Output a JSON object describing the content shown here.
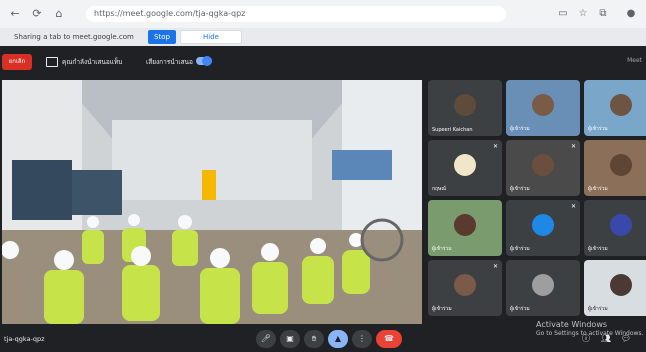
{
  "browser": {
    "url": "https://meet.google.com/tja-qgka-qpz",
    "nav": [
      "back-icon",
      "refresh-icon",
      "home-icon"
    ]
  },
  "share_bar": {
    "message": "Sharing a tab to meet.google.com",
    "stop_label": "Stop",
    "hide_label": "Hide"
  },
  "meet": {
    "stop_label": "ยกเลิก",
    "presenting_label": "คุณกำลังนำเสนอแท็บ",
    "audio_label": "เสียงการนำเสนอ",
    "right_label": "Meet",
    "meeting_code": "tja-qgka-qpz",
    "watermark": "Activate Windows",
    "watermark_sub": "Go to Settings to activate Windows."
  },
  "participants": [
    {
      "name": "Supeeri Kaichan",
      "mic": "muted"
    },
    {
      "name": "ผู้เข้าร่วม",
      "mic": "muted"
    },
    {
      "name": "กฤษณ์",
      "mic": "muted"
    },
    {
      "name": "ผู้เข้าร่วม",
      "mic": "muted"
    },
    {
      "name": "ผู้เข้าร่วม",
      "mic": "muted"
    },
    {
      "name": "ผู้เข้าร่วม",
      "mic": "muted"
    },
    {
      "name": "ผู้เข้าร่วม",
      "mic": "muted"
    },
    {
      "name": "ผู้เข้าร่วม",
      "mic": "muted"
    },
    {
      "name": "ผู้เข้าร่วม",
      "mic": "muted"
    },
    {
      "name": "ผู้เข้าร่วม",
      "mic": "muted"
    },
    {
      "name": "ผู้เข้าร่วม",
      "mic": "muted"
    },
    {
      "name": "ผู้เข้าร่วม",
      "mic": "muted"
    }
  ]
}
